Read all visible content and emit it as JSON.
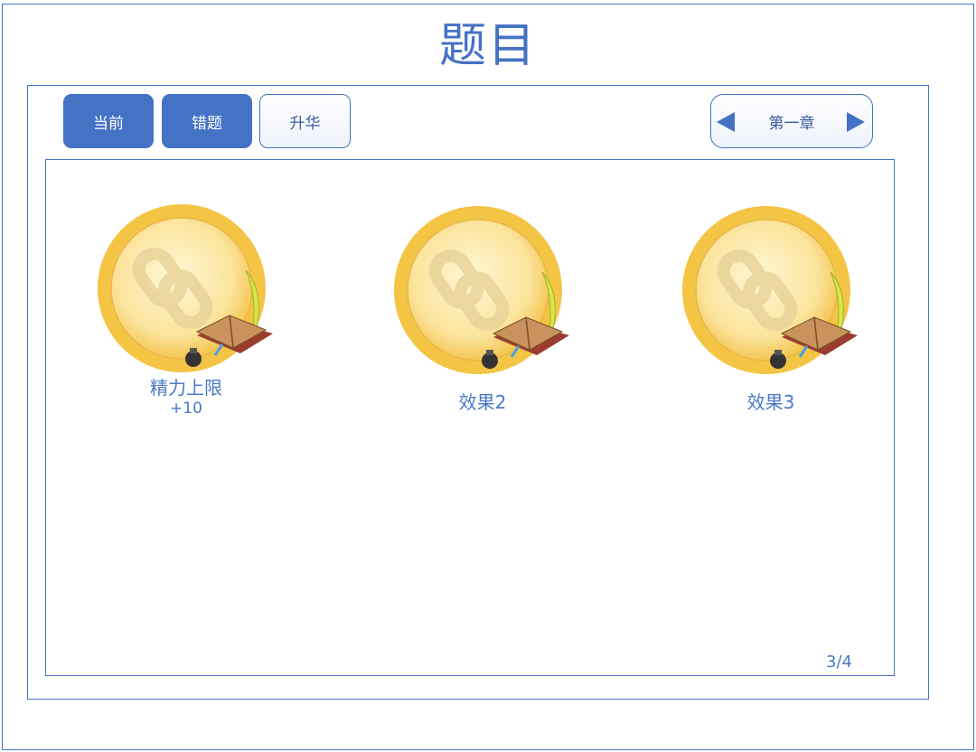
{
  "page": {
    "title": "题目"
  },
  "tabs": [
    {
      "label": "当前",
      "state": "filled"
    },
    {
      "label": "错题",
      "state": "filled"
    },
    {
      "label": "升华",
      "state": "outline"
    }
  ],
  "chapter_nav": {
    "label": "第一章",
    "prev_icon": "triangle-left-icon",
    "next_icon": "triangle-right-icon"
  },
  "cards": [
    {
      "label": "精力上限",
      "sub": "+10",
      "icon": "gold-chain-book-badge-icon"
    },
    {
      "label": "效果2",
      "sub": "",
      "icon": "gold-chain-book-badge-icon"
    },
    {
      "label": "效果3",
      "sub": "",
      "icon": "gold-chain-book-badge-icon"
    }
  ],
  "pagination": {
    "text": "3/4"
  },
  "colors": {
    "accent": "#4472c4",
    "gold": "#f5c84a",
    "book": "#b9824a"
  }
}
